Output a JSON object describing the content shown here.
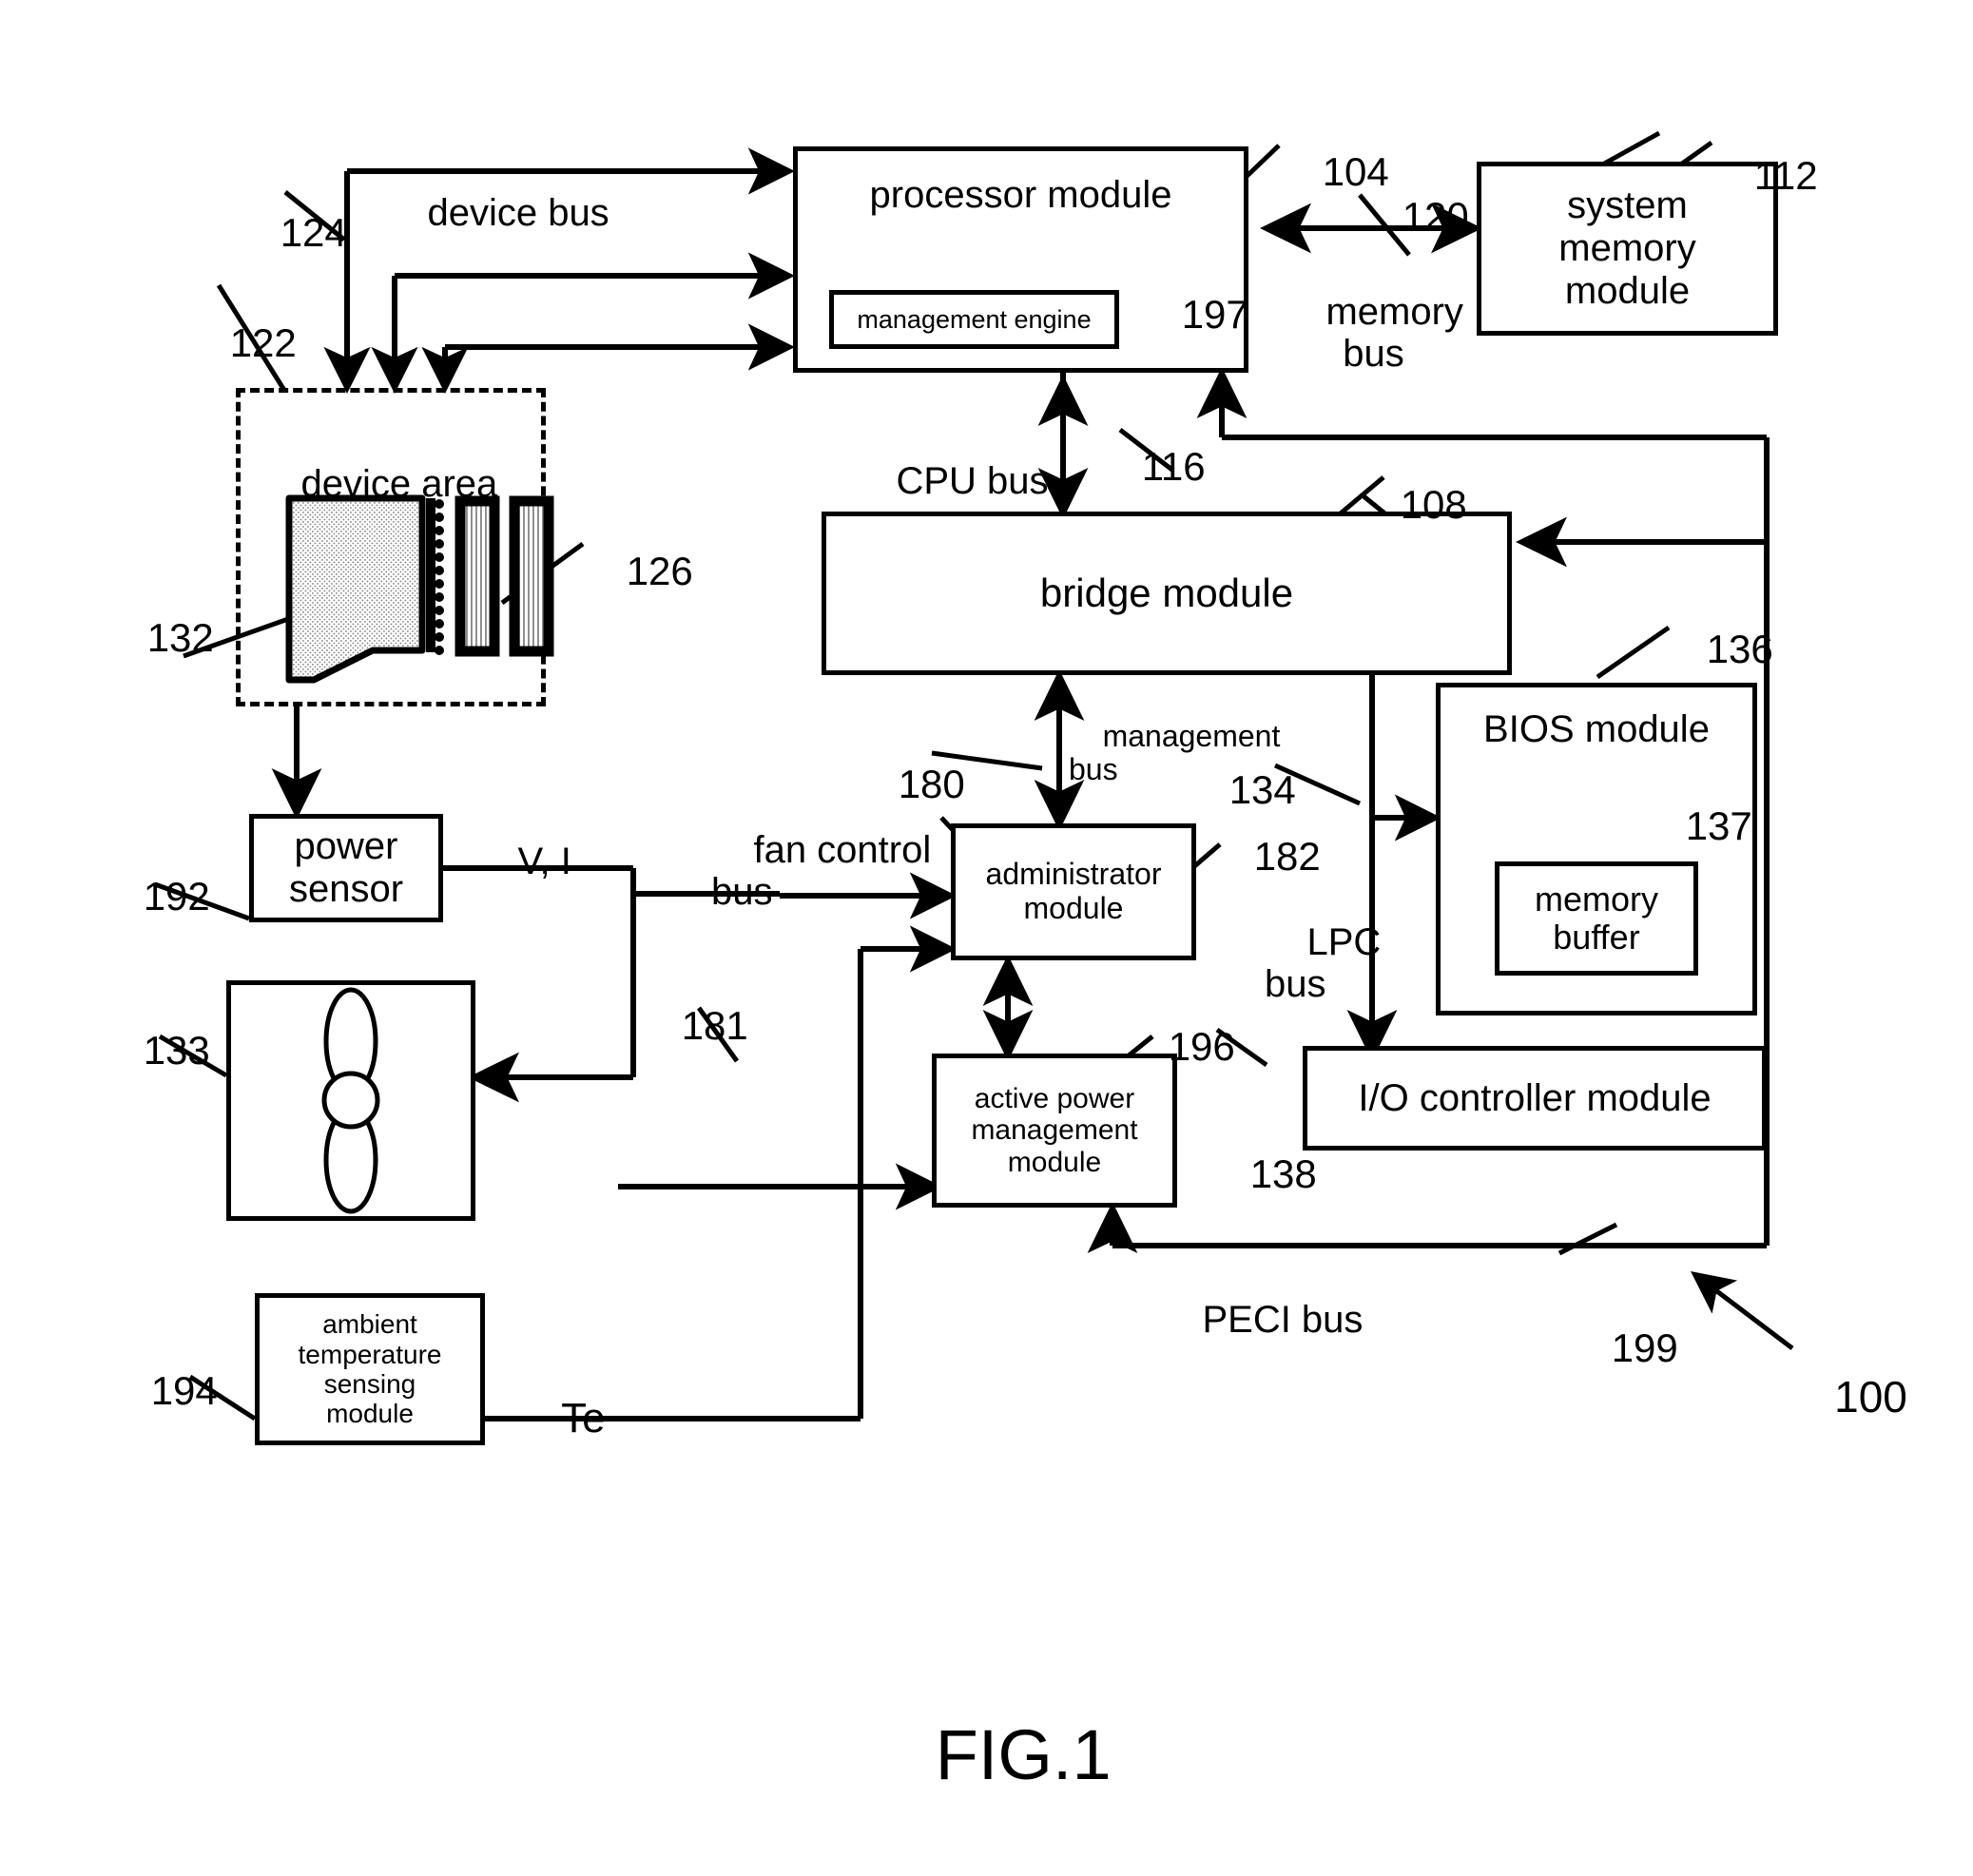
{
  "figure": {
    "caption": "FIG.1",
    "system_ref": "100"
  },
  "blocks": [
    {
      "id": "processor",
      "label": "processor module",
      "ref": "104"
    },
    {
      "id": "mgmt_engine",
      "label": "management engine",
      "ref": "197"
    },
    {
      "id": "sysmem",
      "label": "system\nmemory\nmodule",
      "ref": "112"
    },
    {
      "id": "bridge",
      "label": "bridge module",
      "ref": "108"
    },
    {
      "id": "device_area",
      "label": "device area",
      "ref": "122"
    },
    {
      "id": "power_sensor",
      "label": "power\nsensor",
      "ref": "192"
    },
    {
      "id": "fan",
      "label": "",
      "ref": "133"
    },
    {
      "id": "ambient",
      "label": "ambient\ntemperature\nsensing\nmodule",
      "ref": "194"
    },
    {
      "id": "admin",
      "label": "administrator\nmodule",
      "ref": "182"
    },
    {
      "id": "apm",
      "label": "active power\nmanagement\nmodule",
      "ref": "196"
    },
    {
      "id": "bios",
      "label": "BIOS module",
      "ref": "136"
    },
    {
      "id": "membuf",
      "label": "memory\nbuffer",
      "ref": "137"
    },
    {
      "id": "iocontrol",
      "label": "I/O controller module",
      "ref": "138"
    }
  ],
  "buses": [
    {
      "id": "device_bus",
      "label": "device bus",
      "ref": "124"
    },
    {
      "id": "memory_bus",
      "label": "memory\nbus",
      "ref": "120"
    },
    {
      "id": "cpu_bus",
      "label": "CPU bus",
      "ref": "116"
    },
    {
      "id": "management_bus",
      "label": "management\nbus",
      "ref": "180"
    },
    {
      "id": "fan_control_bus",
      "label": "fan control\nbus",
      "ref": "181"
    },
    {
      "id": "lpc_bus",
      "label": "LPC\nbus",
      "ref": "134"
    },
    {
      "id": "peci_bus",
      "label": "PECI bus",
      "ref": "199"
    }
  ],
  "signals": [
    {
      "id": "vi",
      "label": "V, I"
    },
    {
      "id": "te",
      "label": "Te"
    }
  ],
  "device_parts": {
    "ref": "126",
    "hdd_ref": "132"
  },
  "colors": {
    "ink": "#000000",
    "paper": "#ffffff",
    "hatch": "#9a9a9a"
  }
}
